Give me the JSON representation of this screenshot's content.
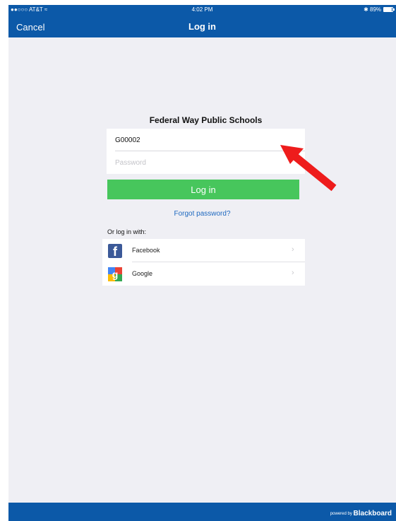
{
  "status_bar": {
    "carrier": "●●○○○ AT&T ≈",
    "time": "4:02 PM",
    "battery": "✱ 89%",
    "battery_level": 0.89
  },
  "nav": {
    "cancel_label": "Cancel",
    "title": "Log in"
  },
  "login": {
    "school_name": "Federal Way Public Schools",
    "username_value": "G00002",
    "password_placeholder": "Password",
    "login_button": "Log in",
    "forgot_link": "Forgot password?"
  },
  "social": {
    "heading": "Or log in with:",
    "items": [
      {
        "label": "Facebook",
        "icon": "facebook-icon"
      },
      {
        "label": "Google",
        "icon": "google-icon"
      }
    ],
    "chevron": "›"
  },
  "footer": {
    "powered_by": "powered by",
    "brand": "Blackboard"
  },
  "colors": {
    "bar": "#0c59a8",
    "button": "#47c65c",
    "link": "#1d68bf",
    "arrow": "#ee1c1c",
    "background": "#efeff4"
  }
}
